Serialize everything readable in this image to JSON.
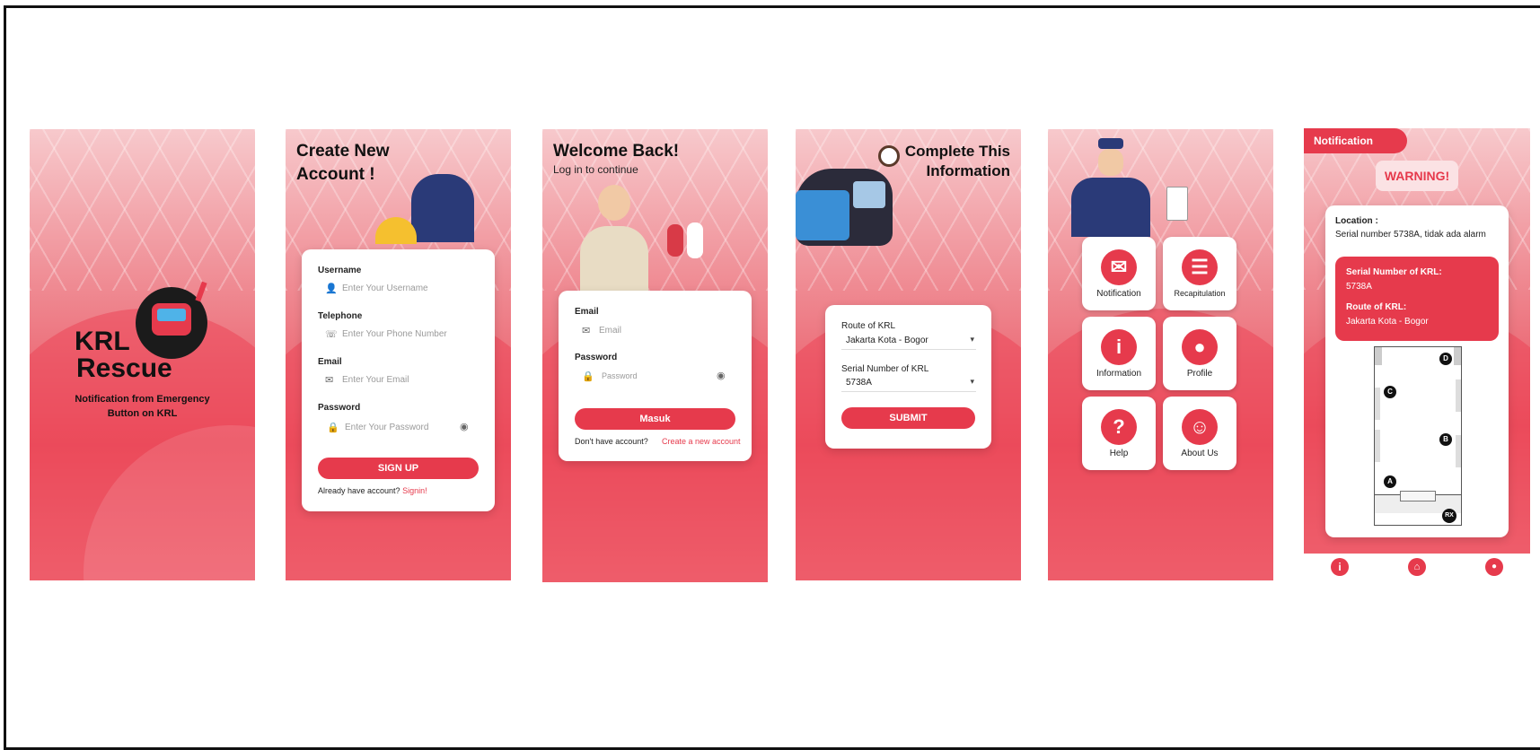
{
  "splash": {
    "app_name_line1": "KRL",
    "app_name_line2": "Rescue",
    "tagline_line1": "Notification  from Emergency",
    "tagline_line2": "Button on KRL"
  },
  "signup": {
    "title_line1": "Create New",
    "title_line2": "Account !",
    "username_label": "Username",
    "username_placeholder": "Enter Your Username",
    "telephone_label": "Telephone",
    "telephone_placeholder": "Enter Your Phone Number",
    "email_label": "Email",
    "email_placeholder": "Enter Your Email",
    "password_label": "Password",
    "password_placeholder": "Enter Your Password",
    "submit_label": "SIGN UP",
    "footer_text": "Already have account?",
    "footer_link": "Signin!"
  },
  "login": {
    "title": "Welcome Back!",
    "subtitle": "Log in to continue",
    "email_label": "Email",
    "email_placeholder": "Email",
    "password_label": "Password",
    "password_placeholder": "Password",
    "submit_label": "Masuk",
    "footer_text": "Don't have account?",
    "footer_link": "Create a new account"
  },
  "info_form": {
    "title_line1": "Complete This",
    "title_line2": "Information",
    "route_label": "Route of KRL",
    "route_value": "Jakarta Kota - Bogor",
    "serial_label": "Serial Number of KRL",
    "serial_value": "5738A",
    "submit_label": "SUBMIT"
  },
  "menu": {
    "tiles": [
      {
        "label": "Notification",
        "icon": "mail-alert-icon",
        "glyph": "✉"
      },
      {
        "label": "Recapitulation",
        "icon": "clipboard-icon",
        "glyph": "☰"
      },
      {
        "label": "Information",
        "icon": "info-icon",
        "glyph": "i"
      },
      {
        "label": "Profile",
        "icon": "profile-icon",
        "glyph": "●"
      },
      {
        "label": "Help",
        "icon": "help-icon",
        "glyph": "?"
      },
      {
        "label": "About Us",
        "icon": "group-icon",
        "glyph": "☺"
      }
    ]
  },
  "notification": {
    "header": "Notification",
    "warning": "WARNING!",
    "location_label": "Location :",
    "location_text": "Serial number 5738A, tidak ada alarm",
    "serial_label": "Serial Number of KRL:",
    "serial_value": "5738A",
    "route_label": "Route of KRL:",
    "route_value": "Jakarta Kota - Bogor",
    "markers": [
      "D",
      "C",
      "B",
      "A",
      "RX"
    ]
  },
  "colors": {
    "accent": "#e63a4c",
    "background": "#ffffff"
  }
}
